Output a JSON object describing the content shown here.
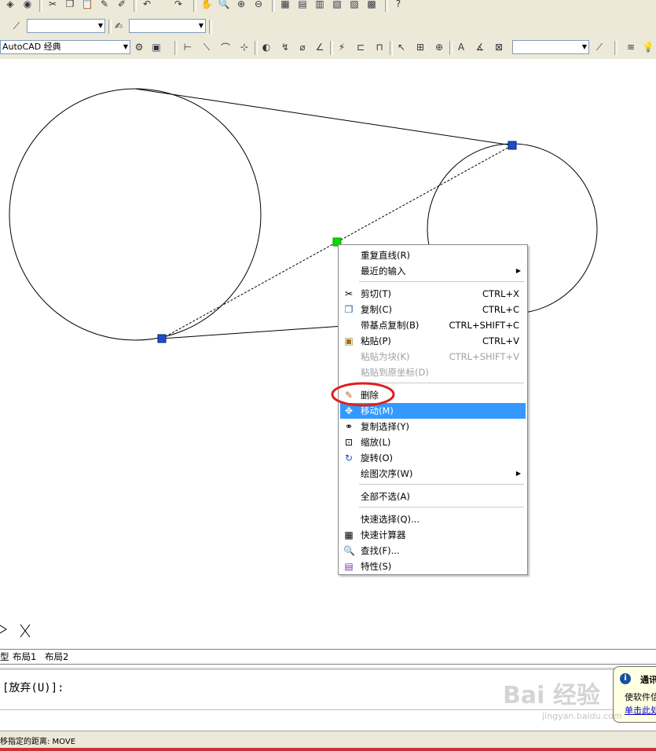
{
  "toolbar": {
    "linetype_combo": "",
    "lineweight_combo": "",
    "workspace_combo": "AutoCAD 经典",
    "dimstyle_combo": ""
  },
  "context_menu": {
    "items": [
      {
        "label": "重复直线(R)",
        "shortcut": "",
        "icon": "",
        "disabled": false,
        "submenu": false
      },
      {
        "label": "最近的输入",
        "shortcut": "",
        "icon": "",
        "disabled": false,
        "submenu": true
      },
      {
        "label": "剪切(T)",
        "shortcut": "CTRL+X",
        "icon": "scissors-icon",
        "disabled": false,
        "submenu": false
      },
      {
        "label": "复制(C)",
        "shortcut": "CTRL+C",
        "icon": "copy-icon",
        "disabled": false,
        "submenu": false
      },
      {
        "label": "带基点复制(B)",
        "shortcut": "CTRL+SHIFT+C",
        "icon": "",
        "disabled": false,
        "submenu": false
      },
      {
        "label": "粘贴(P)",
        "shortcut": "CTRL+V",
        "icon": "paste-icon",
        "disabled": false,
        "submenu": false
      },
      {
        "label": "粘贴为块(K)",
        "shortcut": "CTRL+SHIFT+V",
        "icon": "",
        "disabled": true,
        "submenu": false
      },
      {
        "label": "粘贴到原坐标(D)",
        "shortcut": "",
        "icon": "",
        "disabled": true,
        "submenu": false
      },
      {
        "label": "删除",
        "shortcut": "",
        "icon": "eraser-icon",
        "disabled": false,
        "submenu": false
      },
      {
        "label": "移动(M)",
        "shortcut": "",
        "icon": "move-icon",
        "disabled": false,
        "submenu": false,
        "highlighted": true
      },
      {
        "label": "复制选择(Y)",
        "shortcut": "",
        "icon": "copy-select-icon",
        "disabled": false,
        "submenu": false
      },
      {
        "label": "缩放(L)",
        "shortcut": "",
        "icon": "scale-icon",
        "disabled": false,
        "submenu": false
      },
      {
        "label": "旋转(O)",
        "shortcut": "",
        "icon": "rotate-icon",
        "disabled": false,
        "submenu": false
      },
      {
        "label": "绘图次序(W)",
        "shortcut": "",
        "icon": "",
        "disabled": false,
        "submenu": true
      },
      {
        "label": "全部不选(A)",
        "shortcut": "",
        "icon": "",
        "disabled": false,
        "submenu": false
      },
      {
        "label": "快速选择(Q)...",
        "shortcut": "",
        "icon": "",
        "disabled": false,
        "submenu": false
      },
      {
        "label": "快速计算器",
        "shortcut": "",
        "icon": "calculator-icon",
        "disabled": false,
        "submenu": false
      },
      {
        "label": "查找(F)...",
        "shortcut": "",
        "icon": "find-icon",
        "disabled": false,
        "submenu": false
      },
      {
        "label": "特性(S)",
        "shortcut": "",
        "icon": "properties-icon",
        "disabled": false,
        "submenu": false
      }
    ]
  },
  "layout_tabs": {
    "model_partial": "型",
    "tab1": "布局1",
    "tab2": "布局2"
  },
  "command_line": {
    "prompt": "[放弃(U)]:"
  },
  "status": {
    "text": "移指定的距离:  MOVE"
  },
  "balloon": {
    "title": "通讯",
    "body": "使软件信",
    "link": "单击此处"
  },
  "watermark": {
    "brand": "Bai 经验",
    "url": "jingyan.baidu.com"
  },
  "colors": {
    "highlight": "#3399ff",
    "grip_selected": "#00dd00",
    "grip": "#1f4ccc",
    "annotation_red": "#e01e1e"
  }
}
